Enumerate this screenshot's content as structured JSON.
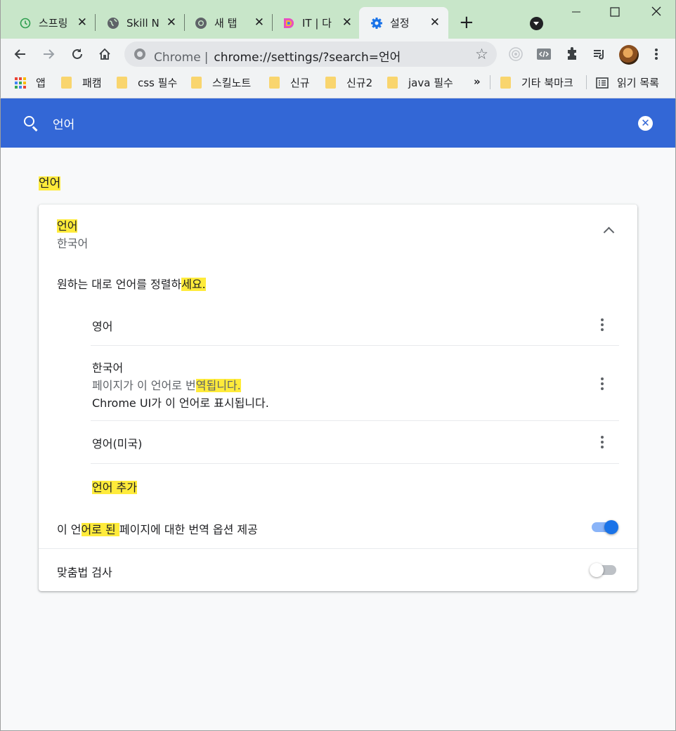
{
  "browser": {
    "tabs": [
      {
        "title": "스프링",
        "icon": "clock-icon"
      },
      {
        "title": "Skill N",
        "icon": "globe-icon"
      },
      {
        "title": "새 탭",
        "icon": "chrome-icon"
      },
      {
        "title": "IT | 다",
        "icon": "d-logo-icon"
      },
      {
        "title": "설정",
        "icon": "gear-icon",
        "active": true
      }
    ],
    "address_prefix": "Chrome",
    "address_url": "chrome://settings/?search=언어",
    "bookmarks": [
      {
        "label": "앱",
        "icon": "apps-grid-icon"
      },
      {
        "label": "패캠",
        "icon": "folder-icon"
      },
      {
        "label": "css 필수",
        "icon": "folder-icon"
      },
      {
        "label": "스킬노트",
        "icon": "folder-icon"
      },
      {
        "label": "신규",
        "icon": "folder-icon"
      },
      {
        "label": "신규2",
        "icon": "folder-icon"
      },
      {
        "label": "java 필수",
        "icon": "folder-icon"
      }
    ],
    "bookmarks_overflow": "»",
    "other_bookmarks": "기타 북마크",
    "reading_list": "읽기 목록"
  },
  "settings": {
    "search_value": "언어",
    "section_title": "언어",
    "language_card": {
      "title": "언어",
      "current_language": "한국어",
      "order_instruction_pre": "원하는 대로 언어를 정렬하",
      "order_instruction_hl": "세요.",
      "languages": [
        {
          "name": "영어"
        },
        {
          "name": "한국어",
          "line1_pre": "페이지가 이 언어로 번",
          "line1_hl": "역됩니다.",
          "line2": "Chrome UI가 이 언어로 표시됩니다."
        },
        {
          "name": "영어(미국)"
        }
      ],
      "add_language": "언어 추가",
      "translate_option_pre": "이 언",
      "translate_option_hl": "어로 된 ",
      "translate_option_post": "페이지에 대한 번역 옵션 제공",
      "translate_enabled": true,
      "spellcheck_label": "맞춤법 검사",
      "spellcheck_enabled": false
    }
  },
  "colors": {
    "header_blue": "#3367d6",
    "highlight": "#ffeb3b",
    "toggle_on": "#1a73e8",
    "tabstrip": "#c8e6c9"
  }
}
